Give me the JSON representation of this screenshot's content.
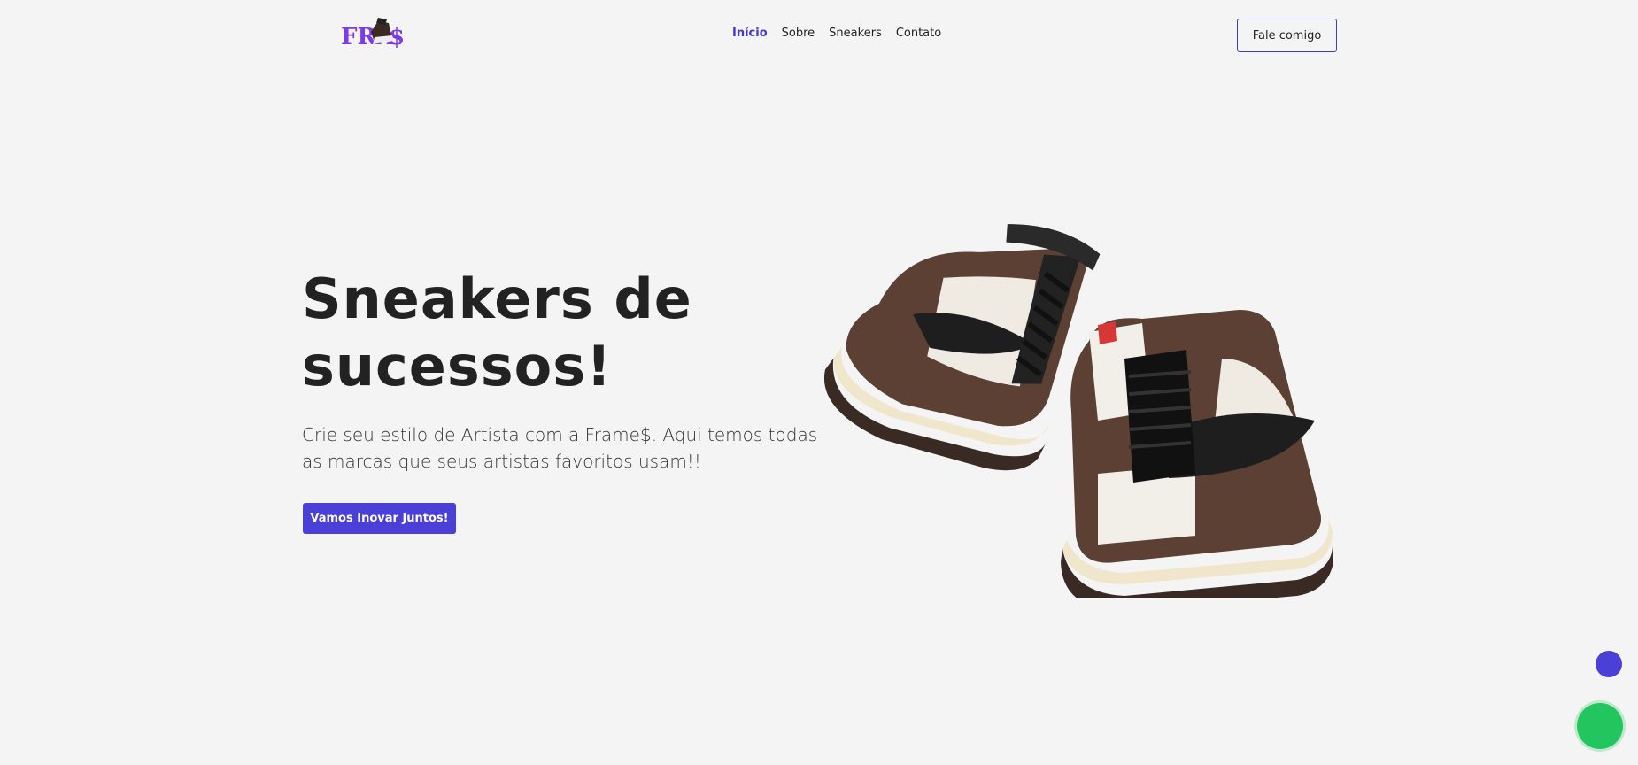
{
  "header": {
    "logo_text": "FRAME$",
    "nav": [
      {
        "label": "Início",
        "active": true
      },
      {
        "label": "Sobre",
        "active": false
      },
      {
        "label": "Sneakers",
        "active": false
      },
      {
        "label": "Contato",
        "active": false
      }
    ],
    "contact_button": "Fale comigo"
  },
  "hero": {
    "title_line1": "Sneakers de",
    "title_line2": "sucessos!",
    "text": "Crie seu estilo de Artista com a Frame$. Aqui temos todas as marcas que seus artistas favoritos usam!!",
    "cta": "Vamos Inovar Juntos!"
  },
  "colors": {
    "accent": "#4a3fd6",
    "nav_active": "#4338ca",
    "background": "#f4f4f4",
    "whatsapp": "#22c55e"
  },
  "icons": {
    "logo": "frames-logo",
    "product": "sneakers-image",
    "scroll_top": "scroll-top-icon",
    "whatsapp": "whatsapp-icon"
  }
}
